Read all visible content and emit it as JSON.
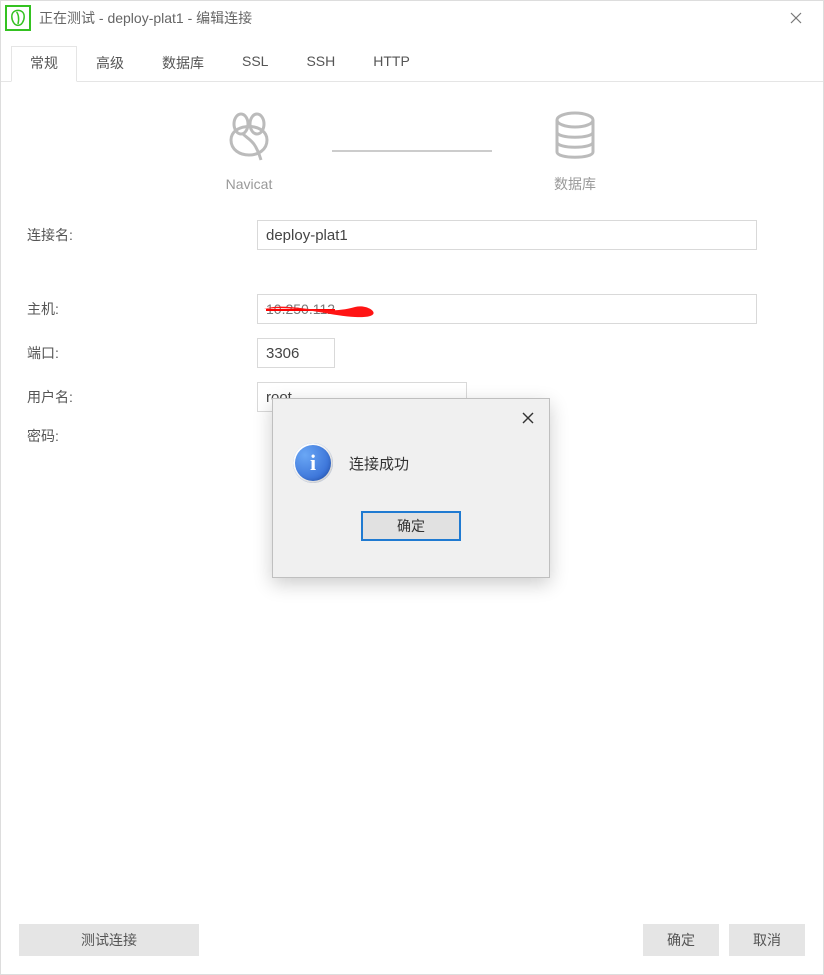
{
  "window": {
    "title": "正在测试 - deploy-plat1 - 编辑连接"
  },
  "tabs": {
    "general": "常规",
    "advanced": "高级",
    "database": "数据库",
    "ssl": "SSL",
    "ssh": "SSH",
    "http": "HTTP"
  },
  "diagram": {
    "left": "Navicat",
    "right": "数据库"
  },
  "form": {
    "connection_name_label": "连接名:",
    "connection_name_value": "deploy-plat1",
    "host_label": "主机:",
    "host_value": "10.250.112",
    "port_label": "端口:",
    "port_value": "3306",
    "user_label": "用户名:",
    "user_value": "root",
    "password_label": "密码:"
  },
  "footer": {
    "test": "测试连接",
    "ok": "确定",
    "cancel": "取消"
  },
  "modal": {
    "message": "连接成功",
    "ok": "确定"
  }
}
